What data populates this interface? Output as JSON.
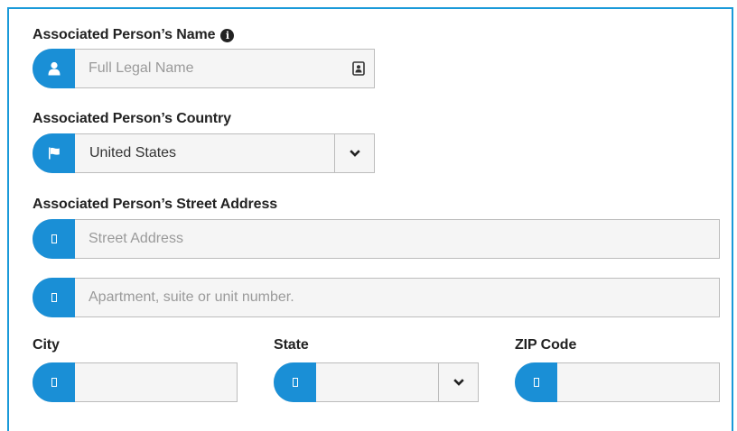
{
  "form": {
    "name": {
      "label": "Associated Person’s Name",
      "info_icon": "info-circle-icon",
      "addon_icon": "user-icon",
      "placeholder": "Full Legal Name",
      "trailing_icon": "contact-card-icon"
    },
    "country": {
      "label": "Associated Person’s Country",
      "addon_icon": "flag-icon",
      "selected": "United States",
      "caret_icon": "chevron-down-icon"
    },
    "street": {
      "label": "Associated Person’s Street Address",
      "line1_placeholder": "Street Address",
      "line2_placeholder": "Apartment, suite or unit number.",
      "addon_icon": "missing-glyph-icon"
    },
    "city": {
      "label": "City",
      "value": "",
      "addon_icon": "missing-glyph-icon"
    },
    "state": {
      "label": "State",
      "selected": "",
      "addon_icon": "missing-glyph-icon",
      "caret_icon": "chevron-down-icon"
    },
    "zip": {
      "label": "ZIP Code",
      "value": "",
      "addon_icon": "missing-glyph-icon"
    }
  },
  "colors": {
    "accent": "#1a8fd6",
    "frame_border": "#1a9ad9",
    "field_border": "#bcbcbc",
    "field_background": "#f5f5f5",
    "label_text": "#222222",
    "placeholder_text": "#9a9a9a"
  }
}
